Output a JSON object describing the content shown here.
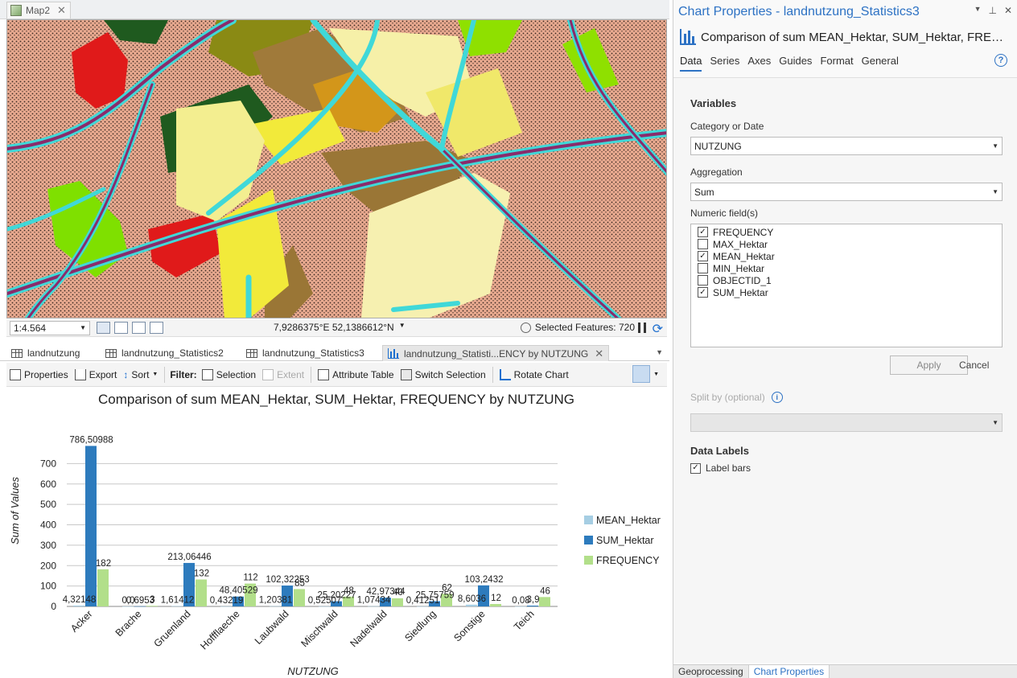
{
  "map_tab": {
    "label": "Map2"
  },
  "statusbar": {
    "scale": "1:4.564",
    "coords": "7,9286375°E 52,1386612°N",
    "selected_features": "Selected Features: 720"
  },
  "view_tabs": [
    {
      "label": "landnutzung"
    },
    {
      "label": "landnutzung_Statistics2"
    },
    {
      "label": "landnutzung_Statistics3"
    },
    {
      "label": "landnutzung_Statisti...ENCY by NUTZUNG"
    }
  ],
  "toolbar": {
    "properties": "Properties",
    "export": "Export",
    "sort": "Sort",
    "filter": "Filter:",
    "selection": "Selection",
    "extent": "Extent",
    "attribute_table": "Attribute Table",
    "switch_selection": "Switch Selection",
    "rotate_chart": "Rotate Chart"
  },
  "chart_data": {
    "type": "bar",
    "title": "Comparison of sum MEAN_Hektar, SUM_Hektar, FREQUENCY by NUTZUNG",
    "xlabel": "NUTZUNG",
    "ylabel": "Sum of Values",
    "ylim": [
      0,
      800
    ],
    "yticks": [
      0,
      100,
      200,
      300,
      400,
      500,
      600,
      700
    ],
    "grid": true,
    "legend_position": "right",
    "categories": [
      "Acker",
      "Brache",
      "Gruenland",
      "Hoffflaeche",
      "Laubwald",
      "Mischwald",
      "Nadelwald",
      "Siedlung",
      "Sonstige",
      "Teich"
    ],
    "series": [
      {
        "name": "MEAN_Hektar",
        "color": "#a6cee3",
        "values": [
          4.32148,
          0.0,
          1.61412,
          0.43219,
          1.20381,
          0.52507,
          1.07434,
          0.41251,
          8.6036,
          0.08
        ],
        "labels": [
          "4,32148",
          "0,0",
          "1,61412",
          "0,43219",
          "1,20381",
          "0,52507",
          "1,07434",
          "0,41251",
          "8,6036",
          "0,08"
        ]
      },
      {
        "name": "SUM_Hektar",
        "color": "#2d7bbd",
        "values": [
          786.50988,
          0.6953,
          213.06446,
          48.40529,
          102.32253,
          25.20227,
          42.97344,
          25.75759,
          103.2432,
          3.9
        ],
        "labels": [
          "786,50988",
          "0,6953",
          "213,06446",
          "48,40529",
          "102,32253",
          "25,20227",
          "42,97344",
          "25,75759",
          "103,2432",
          "3,9"
        ]
      },
      {
        "name": "FREQUENCY",
        "color": "#b2df8a",
        "values": [
          182,
          3,
          132,
          112,
          85,
          48,
          40,
          62,
          12,
          46
        ],
        "labels": [
          "182",
          "3",
          "132",
          "112",
          "85",
          "48",
          "40",
          "62",
          "12",
          "46"
        ]
      }
    ]
  },
  "panel": {
    "title": "Chart Properties - landnutzung_Statistics3",
    "chart_heading": "Comparison of sum MEAN_Hektar, SUM_Hektar, FREQU...",
    "tabs": [
      "Data",
      "Series",
      "Axes",
      "Guides",
      "Format",
      "General"
    ],
    "variables": "Variables",
    "category_label": "Category or Date",
    "category_value": "NUTZUNG",
    "aggregation_label": "Aggregation",
    "aggregation_value": "Sum",
    "numeric_label": "Numeric field(s)",
    "fields": [
      {
        "name": "FREQUENCY",
        "checked": "✓"
      },
      {
        "name": "MAX_Hektar",
        "checked": ""
      },
      {
        "name": "MEAN_Hektar",
        "checked": "✓"
      },
      {
        "name": "MIN_Hektar",
        "checked": ""
      },
      {
        "name": "OBJECTID_1",
        "checked": ""
      },
      {
        "name": "SUM_Hektar",
        "checked": "✓"
      }
    ],
    "apply": "Apply",
    "cancel": "Cancel",
    "split_label": "Split by (optional)",
    "data_labels": "Data Labels",
    "label_bars": "Label bars",
    "label_bars_checked": "✓",
    "bottom_tabs": [
      "Geoprocessing",
      "Chart Properties"
    ]
  }
}
